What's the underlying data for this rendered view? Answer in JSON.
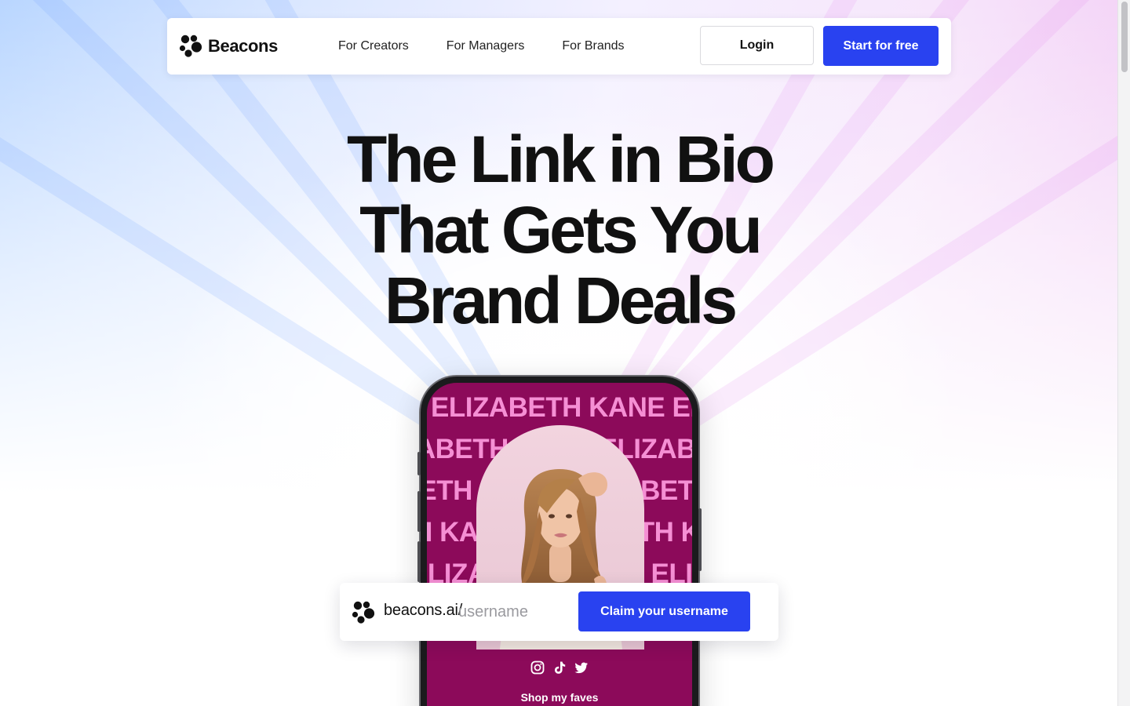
{
  "brand": {
    "name": "Beacons",
    "accent_color": "#2942f0",
    "logo_icon": "beacons-dots-logo"
  },
  "nav": {
    "links": [
      {
        "label": "For Creators"
      },
      {
        "label": "For Managers"
      },
      {
        "label": "For Brands"
      }
    ],
    "login_label": "Login",
    "start_label": "Start for free"
  },
  "hero": {
    "title_lines": [
      "The Link in Bio",
      "That Gets You",
      "Brand Deals"
    ]
  },
  "phone_preview": {
    "name_banner": "ELIZABETH KANE ELIZABETH KANE ELIZABETH KANE",
    "profile_photo": "creator-portrait",
    "background_color": "#8c0a5a",
    "banner_text_color": "#f58fd4",
    "social_icons": [
      "instagram-icon",
      "tiktok-icon",
      "twitter-icon"
    ],
    "shop_label": "Shop my faves"
  },
  "claim": {
    "prefix": "beacons.ai/",
    "input_value": "",
    "input_placeholder": "username",
    "button_label": "Claim your username"
  }
}
